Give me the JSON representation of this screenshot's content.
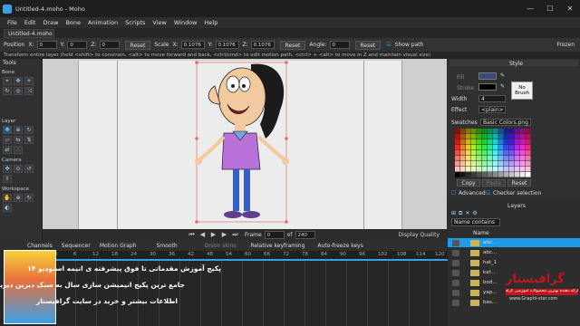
{
  "window": {
    "title": "Untitled-4.moho - Moho",
    "minimize": "—",
    "maximize": "☐",
    "close": "✕"
  },
  "menu": [
    "File",
    "Edit",
    "Draw",
    "Bone",
    "Animation",
    "Scripts",
    "View",
    "Window",
    "Help"
  ],
  "doc_tab": "Untitled-4.moho",
  "tool_options": {
    "position_label": "Position",
    "x_label": "X:",
    "x_val": "0",
    "y_label": "Y:",
    "y_val": "0",
    "z_label": "Z:",
    "z_val": "0",
    "reset": "Reset",
    "scale_label": "Scale",
    "scale_x": "0.1076",
    "scale_y": "0.1076",
    "scale_z": "0.1076",
    "angle_label": "Angle:",
    "angle_val": "0",
    "show_path": "Show path",
    "frozen": "Frozen"
  },
  "status": "Transform entire layer (hold <shift> to constrain, <alt> to move forward and back, <ctrl/cmd> to edit motion path, <ctrl> + <alt> to move in Z and maintain visual size)",
  "tools_panel": {
    "title": "Tools",
    "bone": "Bone",
    "layer": "Layer",
    "camera": "Camera",
    "workspace": "Workspace"
  },
  "frame_bar": {
    "frame_label": "Frame",
    "frame_val": "0",
    "of": "of",
    "end_val": "240",
    "display_quality": "Display Quality"
  },
  "style_panel": {
    "title": "Style",
    "fill_label": "Fill",
    "stroke_label": "Stroke",
    "width_label": "Width",
    "width_val": "4",
    "no_brush": "No Brush",
    "effect_label": "Effect",
    "effect_val": "<plain>",
    "swatches_label": "Swatches",
    "swatches_val": "Basic Colors.png",
    "copy": "Copy",
    "paste": "Paste",
    "reset": "Reset",
    "advanced": "Advanced",
    "checker": "Checker selection"
  },
  "layers_panel": {
    "title": "Layers",
    "name_col": "Name",
    "filter": "Name contains",
    "layers": [
      "abc...",
      "abc...",
      "hat_1",
      "kaf...",
      "bod...",
      "yap...",
      "bas..."
    ]
  },
  "timeline": {
    "tabs": [
      "Channels",
      "Sequencer",
      "Motion Graph"
    ],
    "smooth": "Smooth",
    "onion": "Onion skins",
    "relative": "Relative keyframing",
    "autofreeze": "Auto-freeze keys",
    "ruler": [
      "0",
      "6",
      "12",
      "18",
      "24",
      "30",
      "36",
      "42",
      "48",
      "54",
      "60",
      "66",
      "72",
      "78",
      "84",
      "90",
      "96",
      "102",
      "108",
      "114",
      "120"
    ]
  },
  "promo": {
    "line1": "پکیج آموزش مقدماتی تا فوق پیشرفته ی انیمه استودیو ۱۴",
    "line2": "جامع ترین پکیج انیمیشن سازی سال به سبک دیرین دیرین",
    "line3": "اطلاعات بیشتر و خرید در سایت گرافیستار",
    "brand": "گرافیستار",
    "brand_sub": "ارائه دهنده بهترین محصولات آموزشی گرافیکی",
    "url": "www.Graphi-star.com"
  },
  "colors": {
    "accent": "#3aa0e8",
    "promo_red": "#c0171e"
  }
}
